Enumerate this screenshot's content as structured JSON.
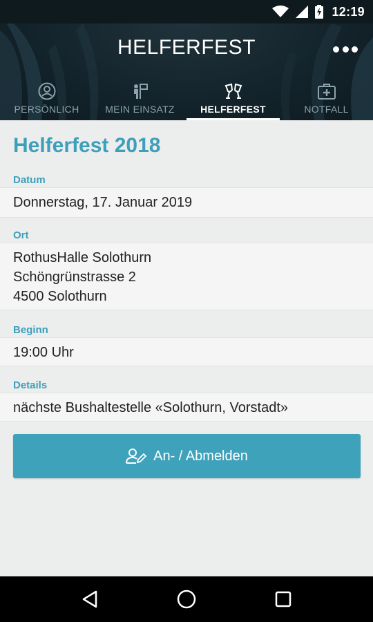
{
  "status_bar": {
    "time": "12:19",
    "icons": [
      "wifi-icon",
      "signal-icon",
      "battery-charging-icon"
    ]
  },
  "header": {
    "title": "HELFERFEST",
    "more_icon": "more-dots-icon"
  },
  "tabs": [
    {
      "label": "PERSÖNLICH",
      "icon": "person-circle-icon",
      "active": false
    },
    {
      "label": "MEIN EINSATZ",
      "icon": "helper-sign-icon",
      "active": false
    },
    {
      "label": "HELFERFEST",
      "icon": "cheers-glasses-icon",
      "active": true
    },
    {
      "label": "NOTFALL",
      "icon": "first-aid-kit-icon",
      "active": false
    }
  ],
  "main": {
    "title": "Helferfest 2018",
    "fields": {
      "datum": {
        "label": "Datum",
        "value": "Donnerstag, 17. Januar 2019"
      },
      "ort": {
        "label": "Ort",
        "lines": [
          "RothusHalle Solothurn",
          "Schöngrünstrasse 2",
          "4500 Solothurn"
        ]
      },
      "beginn": {
        "label": "Beginn",
        "value": "19:00 Uhr"
      },
      "details": {
        "label": "Details",
        "value": "nächste Bushaltestelle «Solothurn, Vorstadt»"
      }
    },
    "button": {
      "label": "An- / Abmelden",
      "icon": "user-edit-icon"
    }
  },
  "nav_bar": {
    "buttons": [
      "back-icon",
      "home-icon",
      "recents-icon"
    ]
  },
  "colors": {
    "accent": "#3d9fba",
    "button": "#3fa2bb",
    "header_bg": "#14242c",
    "tab_inactive": "#8aa3ad"
  }
}
